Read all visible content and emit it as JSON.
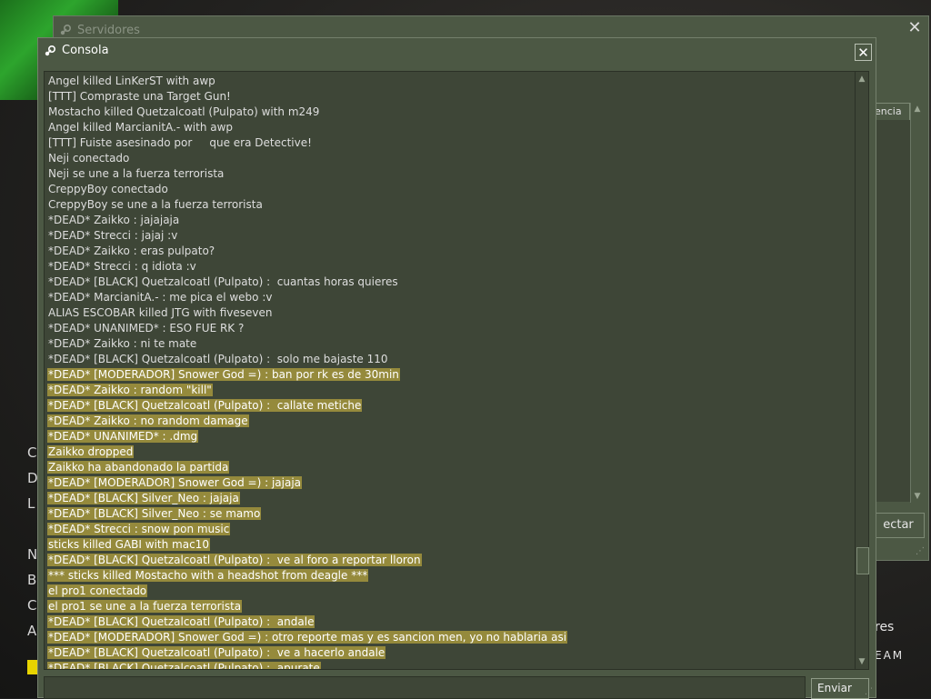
{
  "servers_window": {
    "title": "Servidores",
    "close_glyph": "✕",
    "column_header_partial": "encia",
    "connect_partial": "ectar"
  },
  "background": {
    "left_letters": [
      "C",
      "D",
      "L",
      "",
      "N",
      "B",
      "C",
      "A"
    ],
    "right_text": "res",
    "right_text2": "EAM"
  },
  "console": {
    "title": "Consola",
    "close_glyph": "✕",
    "send_label": "Enviar",
    "input_value": "",
    "lines": [
      {
        "text": "Angel killed LinKerST with awp",
        "hl": false
      },
      {
        "text": "[TTT] Compraste una Target Gun!",
        "hl": false
      },
      {
        "text": "Mostacho killed Quetzalcoatl (Pulpato) with m249",
        "hl": false
      },
      {
        "text": "Angel killed MarcianitA.- with awp",
        "hl": false
      },
      {
        "text": "[TTT] Fuiste asesinado por     que era Detective!",
        "hl": false
      },
      {
        "text": "Neji conectado",
        "hl": false
      },
      {
        "text": "Neji se une a la fuerza terrorista",
        "hl": false
      },
      {
        "text": "CreppyBoy conectado",
        "hl": false
      },
      {
        "text": "CreppyBoy se une a la fuerza terrorista",
        "hl": false
      },
      {
        "text": "*DEAD* Zaikko : jajajaja",
        "hl": false
      },
      {
        "text": "*DEAD* Strecci : jajaj :v",
        "hl": false
      },
      {
        "text": "*DEAD* Zaikko : eras pulpato?",
        "hl": false
      },
      {
        "text": "*DEAD* Strecci : q idiota :v",
        "hl": false
      },
      {
        "text": "*DEAD* [BLACK] Quetzalcoatl (Pulpato) :  cuantas horas quieres",
        "hl": false
      },
      {
        "text": "*DEAD* MarcianitA.- : me pica el webo :v",
        "hl": false
      },
      {
        "text": "ALIAS ESCOBAR killed JTG with fiveseven",
        "hl": false
      },
      {
        "text": "*DEAD* UNANIMED* : ESO FUE RK ?",
        "hl": false
      },
      {
        "text": "*DEAD* Zaikko : ni te mate",
        "hl": false
      },
      {
        "text": "*DEAD* [BLACK] Quetzalcoatl (Pulpato) :  solo me bajaste 110",
        "hl": false
      },
      {
        "text": "*DEAD* [MODERADOR] Snower God =) : ban por rk es de 30min",
        "hl": true
      },
      {
        "text": "*DEAD* Zaikko : random \"kill\"",
        "hl": true
      },
      {
        "text": "*DEAD* [BLACK] Quetzalcoatl (Pulpato) :  callate metiche",
        "hl": true
      },
      {
        "text": "*DEAD* Zaikko : no random damage",
        "hl": true
      },
      {
        "text": "*DEAD* UNANIMED* : .dmg",
        "hl": true
      },
      {
        "text": "Zaikko dropped",
        "hl": true
      },
      {
        "text": "Zaikko ha abandonado la partida",
        "hl": true
      },
      {
        "text": "*DEAD* [MODERADOR] Snower God =) : jajaja",
        "hl": true
      },
      {
        "text": "*DEAD* [BLACK] Silver_Neo : jajaja",
        "hl": true
      },
      {
        "text": "*DEAD* [BLACK] Silver_Neo : se mamo",
        "hl": true
      },
      {
        "text": "*DEAD* Strecci : snow pon music",
        "hl": true
      },
      {
        "text": "sticks killed GABI with mac10",
        "hl": true
      },
      {
        "text": "*DEAD* [BLACK] Quetzalcoatl (Pulpato) :  ve al foro a reportar lloron",
        "hl": true
      },
      {
        "text": "*** sticks killed Mostacho with a headshot from deagle ***",
        "hl": true
      },
      {
        "text": "el pro1 conectado",
        "hl": true
      },
      {
        "text": "el pro1 se une a la fuerza terrorista",
        "hl": true
      },
      {
        "text": "*DEAD* [BLACK] Quetzalcoatl (Pulpato) :  andale",
        "hl": true
      },
      {
        "text": "*DEAD* [MODERADOR] Snower God =) : otro reporte mas y es sancion men, yo no hablaria asi",
        "hl": true
      },
      {
        "text": "*DEAD* [BLACK] Quetzalcoatl (Pulpato) :  ve a hacerlo andale",
        "hl": true
      },
      {
        "text": "*DEAD* [BLACK] Quetzalcoatl (Pulpato) :  apurate",
        "hl": true
      }
    ]
  },
  "colors": {
    "window_bg": "#4c5844",
    "panel_bg": "#3e4637",
    "highlight": "#958a3c"
  },
  "icons": {
    "title_icon": "steam-icon",
    "scroll_up": "arrow-up-icon",
    "scroll_down": "arrow-down-icon",
    "resize": "resize-grip-icon"
  }
}
